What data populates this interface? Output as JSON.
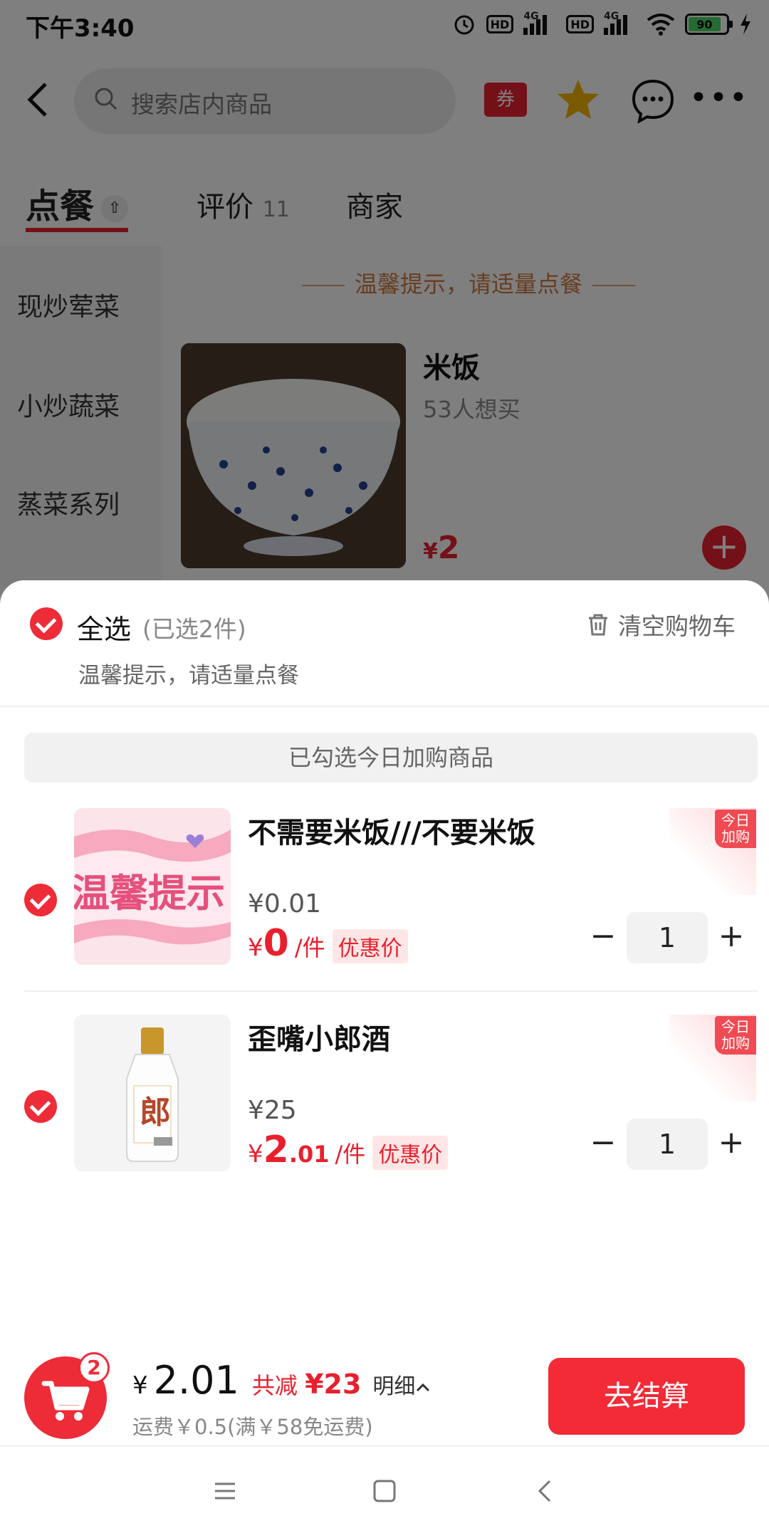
{
  "status_bar": {
    "time": "下午3:40",
    "hd1": "HD",
    "net1": "4G",
    "hd2": "HD",
    "net2": "4G",
    "battery": "90"
  },
  "header": {
    "search_placeholder": "搜索店内商品",
    "coupon_label": "券"
  },
  "tabs": {
    "order": "点餐",
    "reviews": "评价",
    "reviews_count": "11",
    "merchant": "商家"
  },
  "sidebar": {
    "items": [
      {
        "label": "现炒荤菜"
      },
      {
        "label": "小炒蔬菜"
      },
      {
        "label": "蒸菜系列"
      }
    ]
  },
  "menu": {
    "tip": "温馨提示，请适量点餐",
    "product": {
      "name": "米饭",
      "want": "53人想买",
      "currency": "¥",
      "price": "2"
    }
  },
  "cart": {
    "select_all": "全选",
    "selected_count": "(已选2件)",
    "clear": "清空购物车",
    "tip": "温馨提示，请适量点餐",
    "group_banner": "已勾选今日加购商品",
    "items": [
      {
        "name": "不需要米饭///不要米饭",
        "original_price": "¥0.01",
        "currency": "¥",
        "price_int": "0",
        "price_dec": "",
        "unit": "/件",
        "badge": "优惠价",
        "tag_line1": "今日",
        "tag_line2": "加购",
        "qty": "1",
        "thumb_text": "温馨提示"
      },
      {
        "name": "歪嘴小郎酒",
        "original_price": "¥25",
        "currency": "¥",
        "price_int": "2",
        "price_dec": ".01",
        "unit": "/件",
        "badge": "优惠价",
        "tag_line1": "今日",
        "tag_line2": "加购",
        "qty": "1",
        "thumb_text": "郎"
      }
    ]
  },
  "bottom": {
    "cart_count": "2",
    "currency": "¥",
    "total": "2.01",
    "discount_label": "共减",
    "discount_value": "¥23",
    "detail": "明细",
    "shipping": "运费￥0.5(满￥58免运费)",
    "checkout": "去结算"
  },
  "colors": {
    "accent": "#e8202e",
    "checkout": "#f22b37"
  }
}
